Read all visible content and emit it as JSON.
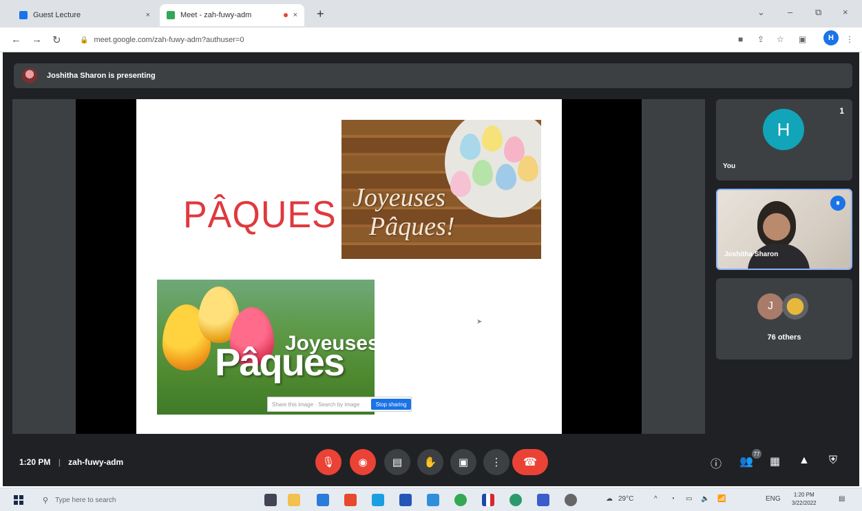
{
  "browser": {
    "tabs": [
      {
        "title": "Guest Lecture",
        "close": "×",
        "color": "#1a73e8",
        "active": false
      },
      {
        "title": "Meet - zah-fuwy-adm",
        "close": "×",
        "color": "#34a853",
        "active": true
      }
    ],
    "new_tab": "+",
    "window_controls": {
      "minimize": "–",
      "maximize": "⧉",
      "close": "×"
    },
    "url": "meet.google.com/zah-fuwy-adm?authuser=0",
    "profile_initial": "H"
  },
  "meet": {
    "presenter_banner": "Joshitha Sharon is presenting",
    "slide": {
      "title": "PÂQUES",
      "image1_text_line1": "Joyeuses",
      "image1_text_line2": "Pâques!",
      "image2_text_line1": "Joyeuses",
      "image2_text_line2": "Pâques",
      "share_bar_placeholder": "Share this image · Search by image",
      "share_bar_button": "Stop sharing"
    },
    "tiles": {
      "self": {
        "initial": "H",
        "name": "You",
        "pin_count": "1"
      },
      "presenter": {
        "name": "Joshitha Sharon"
      },
      "others": {
        "label": "76 others",
        "avatar1_initial": "J"
      }
    },
    "bottom": {
      "time": "1:20 PM",
      "separator": "|",
      "meeting_code": "zah-fuwy-adm",
      "participant_badge": "77"
    }
  },
  "taskbar": {
    "search_placeholder": "Type here to search",
    "weather": "29°C",
    "language": "ENG",
    "clock_time": "1:20 PM",
    "clock_date": "3/22/2022"
  },
  "colors": {
    "meet_bg": "#202124",
    "tile_bg": "#3c4043",
    "red": "#ea4335",
    "accent_blue": "#1a73e8",
    "slide_title": "#e0393e",
    "avatar_teal": "#12a4b8"
  },
  "icons": [
    "mic-off-icon",
    "camera-off-icon",
    "captions-icon",
    "raise-hand-icon",
    "present-icon",
    "more-icon",
    "hangup-icon",
    "info-icon",
    "people-icon",
    "chat-icon",
    "activities-icon",
    "host-controls-icon"
  ]
}
